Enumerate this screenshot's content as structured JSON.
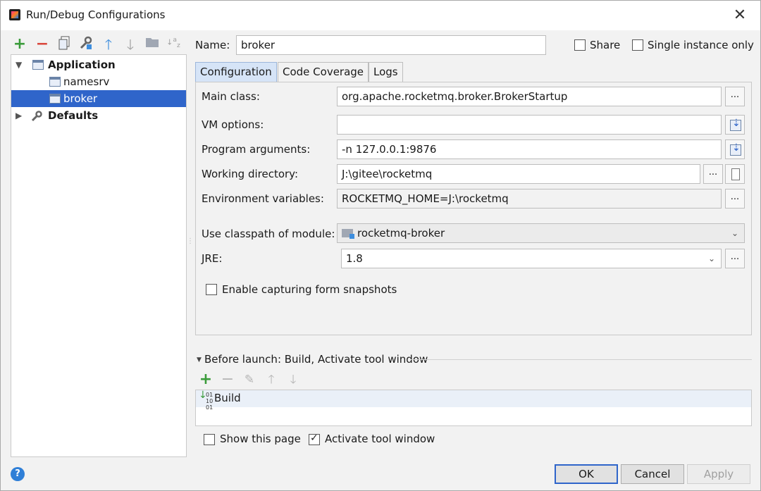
{
  "window": {
    "title": "Run/Debug Configurations"
  },
  "toolbar_left": {
    "icons": [
      "add-icon",
      "remove-icon",
      "copy-icon",
      "edit-defaults-icon",
      "move-up-icon",
      "move-down-icon",
      "folder-icon",
      "sort-icon"
    ]
  },
  "tree": {
    "items": [
      {
        "label": "Application",
        "level": 0,
        "expanded": true,
        "bold": true
      },
      {
        "label": "namesrv",
        "level": 1
      },
      {
        "label": "broker",
        "level": 1,
        "selected": true
      },
      {
        "label": "Defaults",
        "level": 0,
        "expanded": false,
        "bold": true
      }
    ]
  },
  "header": {
    "name_label": "Name:",
    "name_value": "broker",
    "share_label": "Share",
    "share_checked": false,
    "single_instance_label": "Single instance only",
    "single_instance_checked": false
  },
  "tabs": [
    "Configuration",
    "Code Coverage",
    "Logs"
  ],
  "active_tab": "Configuration",
  "config": {
    "main_class_label": "Main class:",
    "main_class_value": "org.apache.rocketmq.broker.BrokerStartup",
    "vm_options_label": "VM options:",
    "vm_options_value": "",
    "program_args_label": "Program arguments:",
    "program_args_value": "-n 127.0.0.1:9876",
    "working_dir_label": "Working directory:",
    "working_dir_value": "J:\\gitee\\rocketmq",
    "env_vars_label": "Environment variables:",
    "env_vars_value": "ROCKETMQ_HOME=J:\\rocketmq",
    "classpath_label": "Use classpath of module:",
    "classpath_value": "rocketmq-broker",
    "jre_label": "JRE:",
    "jre_value": "1.8",
    "snapshots_label": "Enable capturing form snapshots",
    "snapshots_checked": false,
    "dots": "..."
  },
  "before_launch": {
    "title": "Before launch: Build, Activate tool window",
    "items": [
      "Build"
    ]
  },
  "footer": {
    "show_page_label": "Show this page",
    "show_page_checked": false,
    "activate_tool_label": "Activate tool window",
    "activate_tool_checked": true,
    "ok": "OK",
    "cancel": "Cancel",
    "apply": "Apply",
    "help": "?"
  },
  "colors": {
    "selection": "#2f65ca",
    "add_green": "#3a9b3a",
    "remove_red": "#d9463b"
  }
}
